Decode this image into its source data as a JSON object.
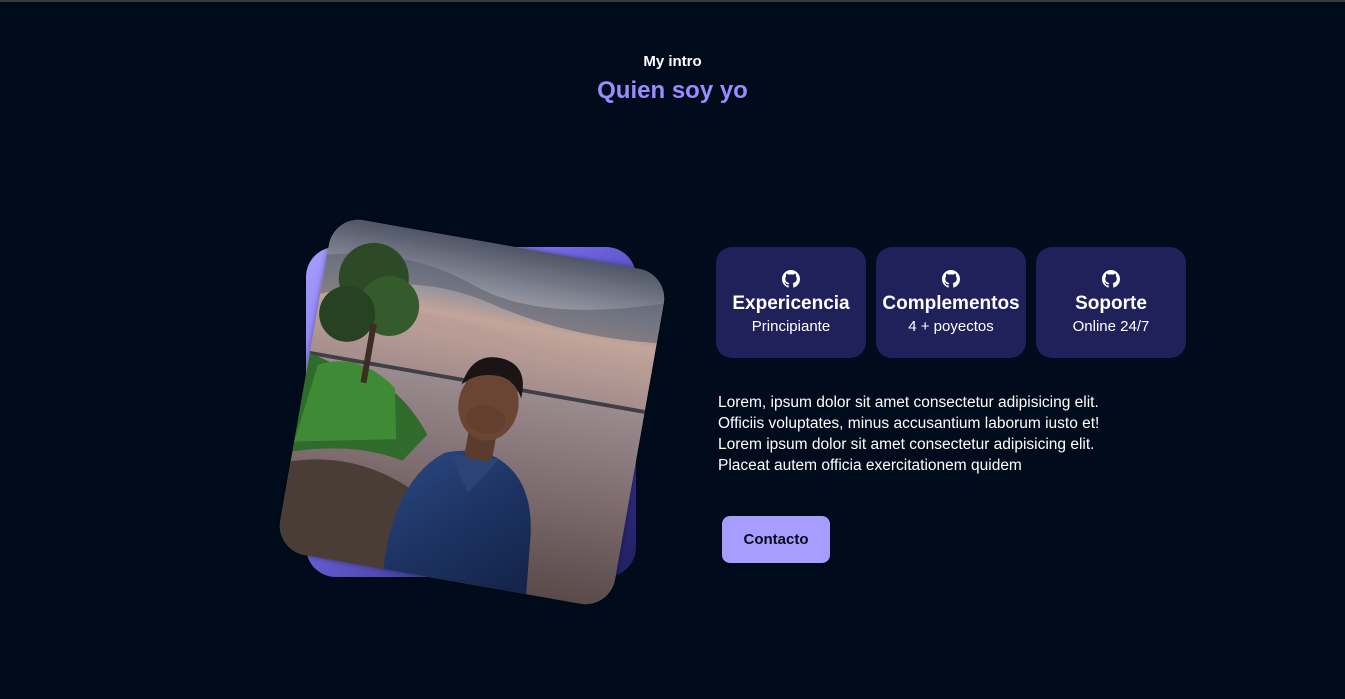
{
  "header": {
    "subtitle": "My intro",
    "title": "Quien soy yo"
  },
  "colors": {
    "background": "#000c1b",
    "accent": "#9a8cff",
    "card_bg": "#20205a",
    "button_bg": "#a79dff"
  },
  "profile_image": {
    "icon": "profile-photo"
  },
  "cards": [
    {
      "icon": "github-icon",
      "title": "Expericencia",
      "subtitle": "Principiante"
    },
    {
      "icon": "github-icon",
      "title": "Complementos",
      "subtitle": "4 + poyectos"
    },
    {
      "icon": "github-icon",
      "title": "Soporte",
      "subtitle": "Online 24/7"
    }
  ],
  "description": "Lorem, ipsum dolor sit amet consectetur adipisicing elit. Officiis voluptates, minus accusantium laborum iusto et! Lorem ipsum dolor sit amet consectetur adipisicing elit. Placeat autem officia exercitationem quidem",
  "contact_button": {
    "label": "Contacto"
  }
}
